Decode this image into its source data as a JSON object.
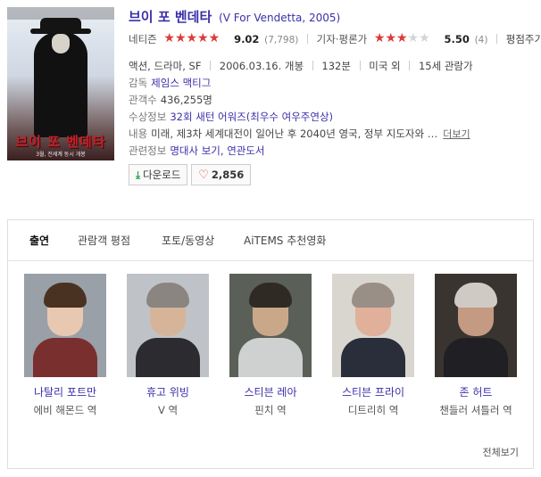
{
  "movie": {
    "title_ko": "브이 포 벤데타",
    "title_en": "(V For Vendetta, 2005)",
    "poster_title": "브이 포 벤데타",
    "poster_date": "3월, 전세계 동시 개봉"
  },
  "ratings": {
    "netizen_label": "네티즌",
    "netizen_score": "9.02",
    "netizen_fill": 0.9,
    "netizen_count": "(7,798)",
    "critic_label": "기자·평론가",
    "critic_score": "5.50",
    "critic_fill": 0.55,
    "critic_count": "(4)",
    "write_review": "평점주기"
  },
  "meta": {
    "genre": "액션, 드라마, SF",
    "release": "2006.03.16. 개봉",
    "runtime": "132분",
    "country": "미국 외",
    "age": "15세 관람가"
  },
  "details": {
    "director_label": "감독",
    "director": "제임스 맥티그",
    "audience_label": "관객수",
    "audience": "436,255명",
    "award_label": "수상정보",
    "award": "32회 새턴 어워즈(최우수 여우주연상)",
    "plot_label": "내용",
    "plot": "미래, 제3차 세계대전이 일어난 후 2040년 영국, 정부 지도자와 …",
    "more": "더보기",
    "related_label": "관련정보",
    "related": "명대사 보기, 연관도서"
  },
  "buttons": {
    "download": "다운로드",
    "likes": "2,856"
  },
  "tabs": [
    "출연",
    "관람객 평점",
    "포토/동영상",
    "AiTEMS 추천영화"
  ],
  "cast": [
    {
      "name": "나탈리 포트만",
      "role": "에비 해몬드 역",
      "skin": "#e8c8b0",
      "hair": "#4a3222",
      "body": "#7a2f2f",
      "bg": "#9aa0a8"
    },
    {
      "name": "휴고 위빙",
      "role": "V 역",
      "skin": "#d6b49a",
      "hair": "#8a8580",
      "body": "#2c2c30",
      "bg": "#bfc3c8"
    },
    {
      "name": "스티븐 레아",
      "role": "핀치 역",
      "skin": "#c9a88a",
      "hair": "#2f2a24",
      "body": "#cfd1d0",
      "bg": "#5a5f58"
    },
    {
      "name": "스티븐 프라이",
      "role": "디트리히 역",
      "skin": "#e0b09a",
      "hair": "#9a8f86",
      "body": "#2a2d3a",
      "bg": "#d9d6d0"
    },
    {
      "name": "존 허트",
      "role": "챈들러 셔틀러 역",
      "skin": "#c49a82",
      "hair": "#cfcac4",
      "body": "#1f1f24",
      "bg": "#3a3430"
    }
  ],
  "see_all": "전체보기",
  "colors": {
    "title_blue": "#3b2fa8",
    "star_red": "#e03a3a",
    "download_green": "#2aa04a"
  }
}
